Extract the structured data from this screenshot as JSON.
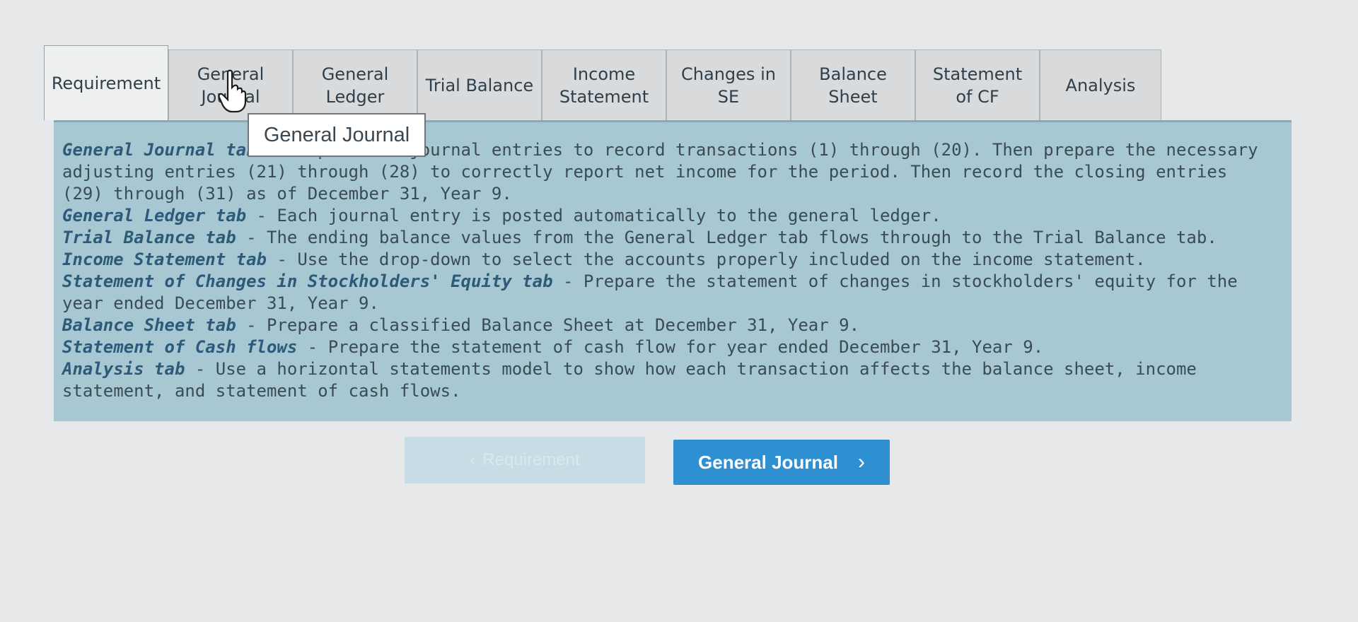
{
  "tabs": [
    {
      "label": "Requirement",
      "active": true
    },
    {
      "label": "General\nJournal"
    },
    {
      "label": "General\nLedger"
    },
    {
      "label": "Trial Balance"
    },
    {
      "label": "Income\nStatement"
    },
    {
      "label": "Changes in\nSE"
    },
    {
      "label": "Balance\nSheet"
    },
    {
      "label": "Statement\nof CF"
    },
    {
      "label": "Analysis"
    }
  ],
  "tooltip": "General Journal",
  "requirements": [
    {
      "title": "General Journal tab",
      "text": " - Prepare the journal entries to record transactions (1) through (20). Then prepare the necessary adjusting entries (21) through (28) to correctly report net income for the period. Then record the closing entries (29) through (31) as of December 31, Year 9."
    },
    {
      "title": "General Ledger tab",
      "text": " - Each journal entry is posted automatically to the general ledger."
    },
    {
      "title": "Trial Balance tab",
      "text": " - The ending balance values from the General Ledger tab flows through to the Trial Balance tab."
    },
    {
      "title": "Income Statement tab",
      "text": " - Use the drop-down to select the accounts properly included on the income statement."
    },
    {
      "title": "Statement of Changes in Stockholders' Equity tab",
      "text": " - Prepare the statement of changes in stockholders' equity for the year ended December 31, Year 9."
    },
    {
      "title": "Balance Sheet tab",
      "text": " - Prepare a classified Balance Sheet at December 31, Year 9."
    },
    {
      "title": "Statement of Cash flows",
      "text": " - Prepare the statement of cash flow for year ended December 31, Year 9."
    },
    {
      "title": "Analysis tab",
      "text": " - Use a horizontal statements model to show how each transaction affects the balance sheet, income statement, and statement of cash flows."
    }
  ],
  "nav": {
    "prev_label": "Requirement",
    "next_label": "General Journal"
  },
  "colors": {
    "panel": "#a7c8d3",
    "accent": "#2e8fd1",
    "title": "#2c5a78"
  }
}
